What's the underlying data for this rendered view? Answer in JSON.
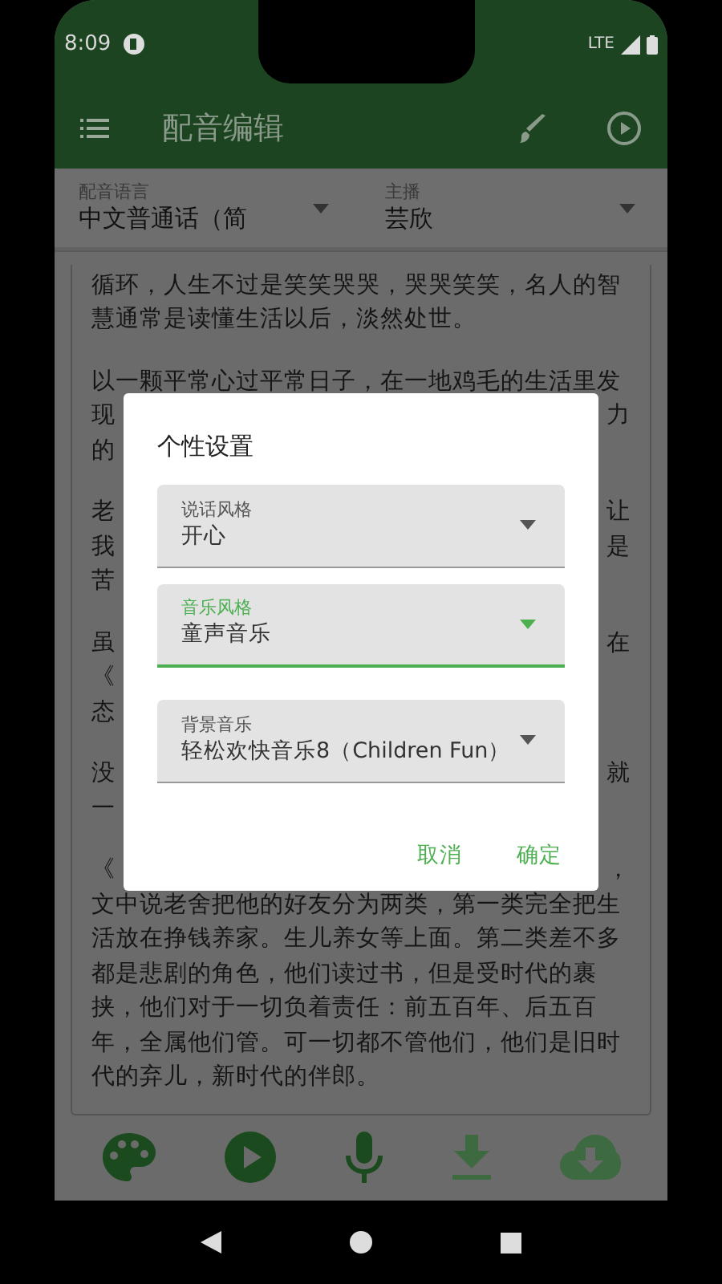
{
  "status_bar": {
    "time": "8:09",
    "network": "LTE"
  },
  "app_bar": {
    "title": "配音编辑"
  },
  "selectors": [
    {
      "label": "配音语言",
      "value": "中文普通话（简"
    },
    {
      "label": "主播",
      "value": "芸欣"
    }
  ],
  "article_paragraphs": [
    {
      "lines": [
        {
          "left": "循环，人生不过是笑笑哭哭，哭哭笑笑，名人的智"
        },
        {
          "left": "慧通常是读懂生活以后，淡然处世。"
        }
      ]
    },
    {
      "lines": [
        {
          "left": "以一颗平常心过平常日子，在一地鸡毛的生活里发"
        },
        {
          "left": "现",
          "right": "力"
        },
        {
          "left": "的"
        }
      ]
    },
    {
      "lines": [
        {
          "left": "老",
          "right": "让"
        },
        {
          "left": "我",
          "right": "是"
        },
        {
          "left": "苦"
        }
      ]
    },
    {
      "lines": [
        {
          "left": "虽",
          "right": "在"
        },
        {
          "left": "《"
        },
        {
          "left": "态"
        }
      ]
    },
    {
      "lines": [
        {
          "left": "没",
          "right": "就"
        },
        {
          "left": "一"
        }
      ]
    },
    {
      "lines": [
        {
          "left": "《",
          "right": "，"
        },
        {
          "left": "文中说老舍把他的好友分为两类，第一类完全把生"
        },
        {
          "left": "活放在挣钱养家。生儿养女等上面。第二类差不多"
        },
        {
          "left": "都是悲剧的角色，他们读过书，但是受时代的裹"
        },
        {
          "left": "挟，他们对于一切负着责任：前五百年、后五百"
        },
        {
          "left": "年，全属他们管。可一切都不管他们，他们是旧时"
        },
        {
          "left": "代的弃儿，新时代的伴郎。"
        }
      ]
    }
  ],
  "toolbar": [
    {
      "kind": "palette",
      "disabled": false
    },
    {
      "kind": "play",
      "disabled": false
    },
    {
      "kind": "mic",
      "disabled": false
    },
    {
      "kind": "download",
      "disabled": true
    },
    {
      "kind": "cloud",
      "disabled": true
    }
  ],
  "dialog": {
    "title": "个性设置",
    "fields": [
      {
        "label": "说话风格",
        "value": "开心",
        "focused": false
      },
      {
        "label": "音乐风格",
        "value": "童声音乐",
        "focused": true
      },
      {
        "label": "背景音乐",
        "value": "轻松欢快音乐8（Children Fun）",
        "focused": false
      }
    ],
    "buttons": [
      {
        "label": "取消"
      },
      {
        "label": "确定"
      }
    ]
  }
}
